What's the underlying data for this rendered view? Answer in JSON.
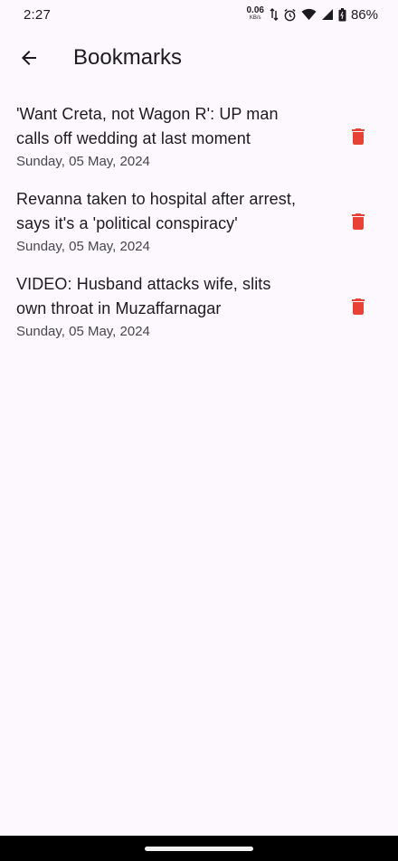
{
  "status_bar": {
    "time": "2:27",
    "net_speed_value": "0.06",
    "net_speed_unit": "KB/s",
    "battery": "86%"
  },
  "app_bar": {
    "title": "Bookmarks",
    "back_icon": "arrow-back-icon"
  },
  "colors": {
    "background": "#fdf8fd",
    "delete_icon": "#e84136",
    "title_text": "#1c1b1f",
    "date_text": "#45464f"
  },
  "bookmarks": [
    {
      "title_line1": "'Want Creta, not Wagon R': UP man",
      "title_line2": "calls off wedding at last moment",
      "date": "Sunday, 05 May, 2024",
      "icon": "delete-icon"
    },
    {
      "title_line1": "Revanna taken to hospital after arrest,",
      "title_line2": "says it's a 'political conspiracy'",
      "date": "Sunday, 05 May, 2024",
      "icon": "delete-icon"
    },
    {
      "title_line1": "VIDEO: Husband attacks wife, slits",
      "title_line2": "own throat in Muzaffarnagar",
      "date": "Sunday, 05 May, 2024",
      "icon": "delete-icon"
    }
  ]
}
